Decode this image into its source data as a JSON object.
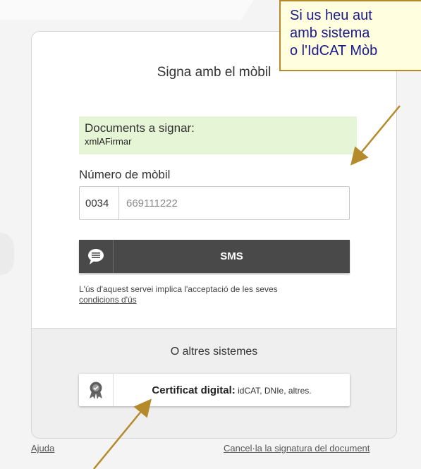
{
  "card": {
    "title": "Signa amb el mòbil",
    "documents_label": "Documents a signar:",
    "document_name": "xmlAFirmar",
    "phone_label": "Número de mòbil",
    "phone_prefix": "0034",
    "phone_value": "669111222",
    "sms_button_label": "SMS",
    "terms_text": "L'ús d'aquest servei implica l'acceptació de les seves",
    "terms_link": "condicions d'ús",
    "others_title": "O altres sistemes",
    "cert_button_bold": "Certificat digital:",
    "cert_button_rest": " idCAT, DNIe, altres."
  },
  "footer": {
    "help_link": "Ajuda",
    "cancel_link": "Cancel·la la signatura del document"
  },
  "callout": {
    "line1": "Si us heu aut",
    "line2": "amb sistema",
    "line3": "o l'IdCAT Mòb"
  },
  "colors": {
    "callout_border": "#b58a2a",
    "callout_text": "#1a1a8a",
    "doc_box_bg": "#e6f5d5",
    "sms_button_bg": "#494949"
  },
  "icons": {
    "sms": "chat-bubble-icon",
    "cert": "certificate-badge-icon"
  }
}
